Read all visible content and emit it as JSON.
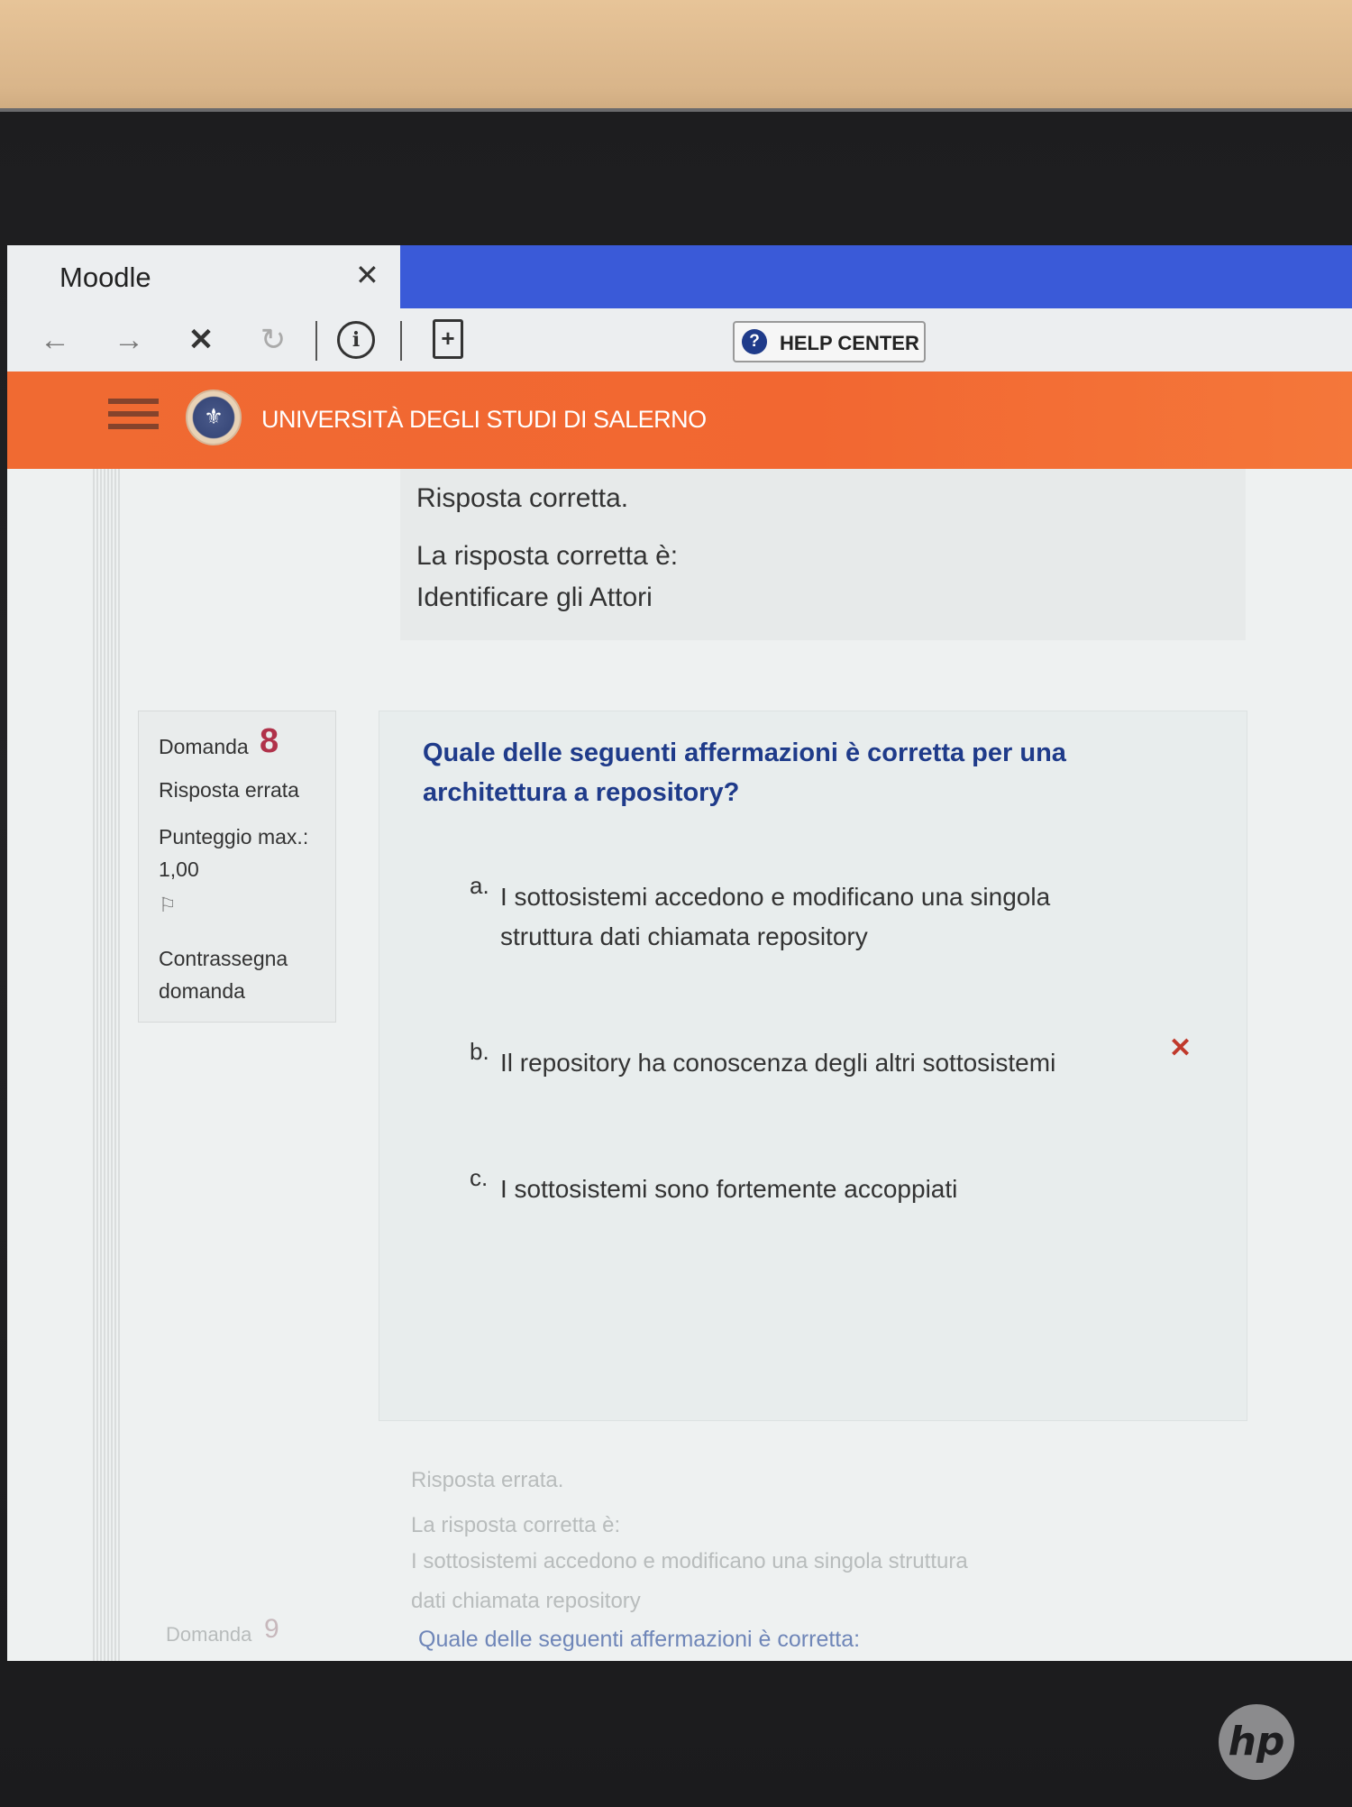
{
  "browser": {
    "tab_title": "Moodle",
    "tab_close_icon": "close-icon",
    "help_button_label": "HELP CENTER",
    "help_icon": "?"
  },
  "header": {
    "university_name": "UNIVERSITÀ DEGLI STUDI DI SALERNO"
  },
  "previous_feedback": {
    "result": "Risposta corretta.",
    "correct_answer_label": "La risposta corretta è:",
    "correct_answer": "Identificare gli Attori"
  },
  "question": {
    "word": "Domanda",
    "number": "8",
    "status": "Risposta errata",
    "score_label": "Punteggio max.:",
    "score_value": "1,00",
    "flag_label": "Contrassegna domanda",
    "text": "Quale delle seguenti affermazioni è corretta per una architettura a repository?",
    "options": [
      {
        "letter": "a.",
        "text": "I sottosistemi accedono e modificano una singola struttura dati chiamata repository"
      },
      {
        "letter": "b.",
        "text": "Il repository ha conoscenza degli altri sottosistemi",
        "selected_wrong": true
      },
      {
        "letter": "c.",
        "text": "I sottosistemi sono fortemente accoppiati"
      }
    ]
  },
  "feedback": {
    "result": "Risposta errata.",
    "correct_answer_label": "La risposta corretta è:",
    "correct_answer_line1": "I sottosistemi accedono e modificano una singola struttura",
    "correct_answer_line2": "dati chiamata repository"
  },
  "next_question": {
    "word": "Domanda",
    "number": "9",
    "text": "Quale delle seguenti affermazioni è corretta:"
  },
  "colors": {
    "accent_orange": "#f26731",
    "tab_blue": "#3a5ad8",
    "question_blue": "#1f3b8a",
    "wrong_red": "#c0392b"
  }
}
